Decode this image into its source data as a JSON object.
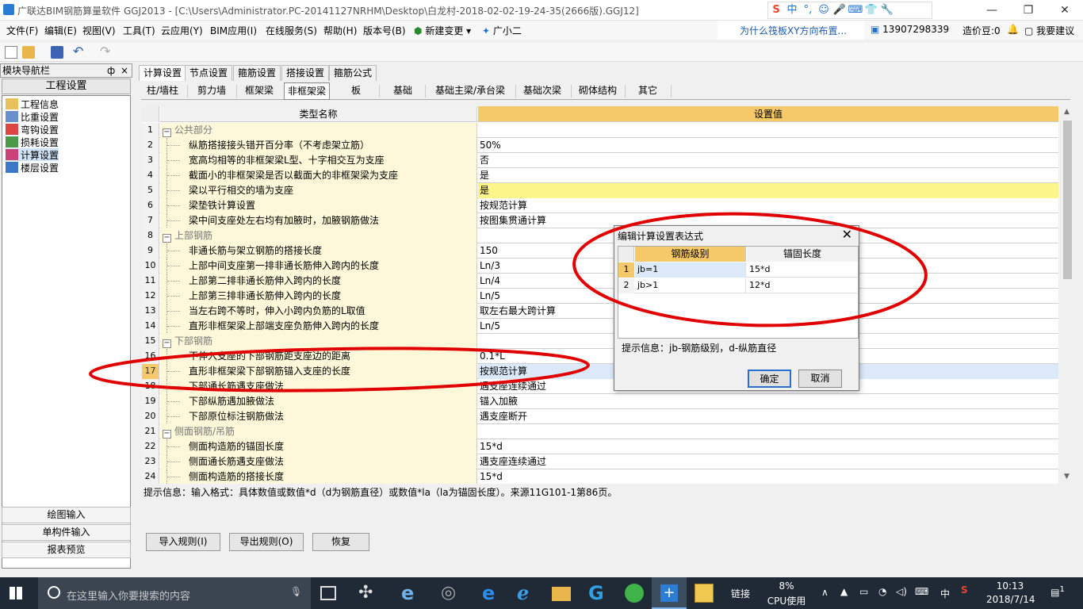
{
  "window": {
    "title": "广联达BIM钢筋算量软件 GGJ2013 - [C:\\Users\\Administrator.PC-20141127NRHM\\Desktop\\白龙村-2018-02-02-19-24-35(2666版).GGJ12]",
    "minimize": "—",
    "maximize": "❐",
    "close": "✕"
  },
  "ime": {
    "icons": [
      "S",
      "中",
      "°,",
      "☺",
      "🎤",
      "⌨",
      "👕",
      "🔧"
    ]
  },
  "menu": {
    "items": [
      "文件(F)",
      "编辑(E)",
      "视图(V)",
      "工具(T)",
      "云应用(Y)",
      "BIM应用(I)",
      "在线服务(S)",
      "帮助(H)",
      "版本号(B)",
      "新建变更",
      "广小二"
    ],
    "tip_question": "为什么筏板XY方向布置...",
    "account": "13907298339",
    "beans": "造价豆:0",
    "suggest": "我要建议"
  },
  "nav": {
    "header": "模块导航栏",
    "pin": "ф",
    "close": "×",
    "section": "工程设置",
    "items": [
      "工程信息",
      "比重设置",
      "弯钩设置",
      "损耗设置",
      "计算设置",
      "楼层设置"
    ],
    "bottom_buttons": [
      "绘图输入",
      "单构件输入",
      "报表预览"
    ]
  },
  "tabs_top": [
    "计算设置",
    "节点设置",
    "箍筋设置",
    "搭接设置",
    "箍筋公式"
  ],
  "tabs_sub": [
    "柱/墙柱",
    "剪力墙",
    "框架梁",
    "非框架梁",
    "板",
    "基础",
    "基础主梁/承台梁",
    "基础次梁",
    "砌体结构",
    "其它"
  ],
  "grid": {
    "col_name": "类型名称",
    "col_value": "设置值",
    "rows": [
      {
        "n": "1",
        "name": "公共部分",
        "value": "",
        "group": true
      },
      {
        "n": "2",
        "name": "纵筋搭接接头错开百分率（不考虑架立筋）",
        "value": "50%"
      },
      {
        "n": "3",
        "name": "宽高均相等的非框架梁L型、十字相交互为支座",
        "value": "否"
      },
      {
        "n": "4",
        "name": "截面小的非框架梁是否以截面大的非框架梁为支座",
        "value": "是"
      },
      {
        "n": "5",
        "name": "梁以平行相交的墙为支座",
        "value": "是",
        "highlight": true
      },
      {
        "n": "6",
        "name": "梁垫铁计算设置",
        "value": "按规范计算"
      },
      {
        "n": "7",
        "name": "梁中间支座处左右均有加腋时，加腋钢筋做法",
        "value": "按图集贯通计算"
      },
      {
        "n": "8",
        "name": "上部钢筋",
        "value": "",
        "group": true
      },
      {
        "n": "9",
        "name": "非通长筋与架立钢筋的搭接长度",
        "value": "150"
      },
      {
        "n": "10",
        "name": "上部中间支座第一排非通长筋伸入跨内的长度",
        "value": "Ln/3"
      },
      {
        "n": "11",
        "name": "上部第二排非通长筋伸入跨内的长度",
        "value": "Ln/4"
      },
      {
        "n": "12",
        "name": "上部第三排非通长筋伸入跨内的长度",
        "value": "Ln/5"
      },
      {
        "n": "13",
        "name": "当左右跨不等时，伸入小跨内负筋的L取值",
        "value": "取左右最大跨计算"
      },
      {
        "n": "14",
        "name": "直形非框架梁上部端支座负筋伸入跨内的长度",
        "value": "Ln/5"
      },
      {
        "n": "15",
        "name": "下部钢筋",
        "value": "",
        "group": true
      },
      {
        "n": "16",
        "name": "不伸入支座的下部钢筋距支座边的距离",
        "value": "0.1*L"
      },
      {
        "n": "17",
        "name": "直形非框架梁下部钢筋锚入支座的长度",
        "value": "按规范计算",
        "selected": true
      },
      {
        "n": "18",
        "name": "下部通长筋遇支座做法",
        "value": "遇支座连续通过"
      },
      {
        "n": "19",
        "name": "下部纵筋遇加腋做法",
        "value": "锚入加腋"
      },
      {
        "n": "20",
        "name": "下部原位标注钢筋做法",
        "value": "遇支座断开"
      },
      {
        "n": "21",
        "name": "侧面钢筋/吊筋",
        "value": "",
        "group": true
      },
      {
        "n": "22",
        "name": "侧面构造筋的锚固长度",
        "value": "15*d"
      },
      {
        "n": "23",
        "name": "侧面通长筋遇支座做法",
        "value": "遇支座连续通过"
      },
      {
        "n": "24",
        "name": "侧面构造筋的搭接长度",
        "value": "15*d"
      }
    ]
  },
  "hint": "提示信息：输入格式：具体数值或数值*d（d为钢筋直径）或数值*la（la为锚固长度）。来源11G101-1第86页。",
  "buttons": {
    "import": "导入规则(I)",
    "export": "导出规则(O)",
    "restore": "恢复"
  },
  "dialog": {
    "title": "编辑计算设置表达式",
    "close": "✕",
    "col_grade": "钢筋级别",
    "col_anchor": "锚固长度",
    "rows": [
      {
        "n": "1",
        "grade": "jb=1",
        "anchor": "15*d"
      },
      {
        "n": "2",
        "grade": "jb>1",
        "anchor": "12*d"
      }
    ],
    "tip": "提示信息：jb-钢筋级别，d-纵筋直径",
    "ok": "确定",
    "cancel": "取消"
  },
  "taskbar": {
    "search_placeholder": "在这里输入你要搜索的内容",
    "link": "链接",
    "cpu_pct": "8%",
    "cpu_label": "CPU使用",
    "lang": "中",
    "time": "10:13",
    "date": "2018/7/14",
    "notif": "1"
  },
  "colors": {
    "header_orange": "#f5c86a",
    "name_cell": "#fcf8d9",
    "highlight_row": "#fcf58a",
    "selected_row": "#dbe9f8",
    "annotation": "#e00000",
    "taskbar": "#1f2a36"
  }
}
